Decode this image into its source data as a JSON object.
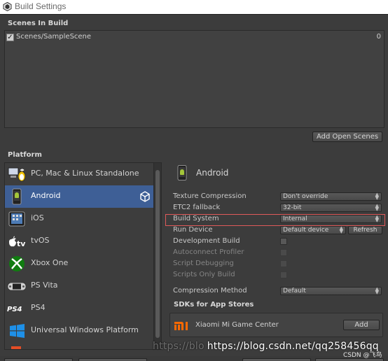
{
  "window": {
    "title": "Build Settings"
  },
  "scenes": {
    "header": "Scenes In Build",
    "items": [
      {
        "name": "Scenes/SampleScene",
        "index": "0",
        "checked": true
      }
    ],
    "add_button": "Add Open Scenes"
  },
  "platform": {
    "header": "Platform",
    "items": [
      {
        "label": "PC, Mac & Linux Standalone",
        "icon": "pc-mac-linux-icon"
      },
      {
        "label": "Android",
        "icon": "android-icon",
        "selected": true
      },
      {
        "label": "iOS",
        "icon": "ios-icon"
      },
      {
        "label": "tvOS",
        "icon": "tvos-icon"
      },
      {
        "label": "Xbox One",
        "icon": "xbox-icon"
      },
      {
        "label": "PS Vita",
        "icon": "ps-vita-icon"
      },
      {
        "label": "PS4",
        "icon": "ps4-icon"
      },
      {
        "label": "Universal Windows Platform",
        "icon": "windows-icon"
      }
    ]
  },
  "settings": {
    "platform_title": "Android",
    "rows": {
      "texture_compression": {
        "label": "Texture Compression",
        "value": "Don't override"
      },
      "etc2_fallback": {
        "label": "ETC2 fallback",
        "value": "32-bit"
      },
      "build_system": {
        "label": "Build System",
        "value": "Internal"
      },
      "run_device": {
        "label": "Run Device",
        "value": "Default device",
        "refresh": "Refresh"
      },
      "development_build": {
        "label": "Development Build"
      },
      "autoconnect_profiler": {
        "label": "Autoconnect Profiler"
      },
      "script_debugging": {
        "label": "Script Debugging"
      },
      "scripts_only_build": {
        "label": "Scripts Only Build"
      },
      "compression_method": {
        "label": "Compression Method",
        "value": "Default"
      }
    },
    "sdk": {
      "header": "SDKs for App Stores",
      "store_name": "Xiaomi Mi Game Center",
      "add_button": "Add"
    }
  },
  "watermark": {
    "faint_prefix": "https://blo",
    "url": "https://blog.csdn.net/qq258456qq",
    "small": "CSDN @飞鸟"
  },
  "colors": {
    "selected": "#3e5f96",
    "highlight": "#e05a5a",
    "background": "#3c3c3c"
  }
}
